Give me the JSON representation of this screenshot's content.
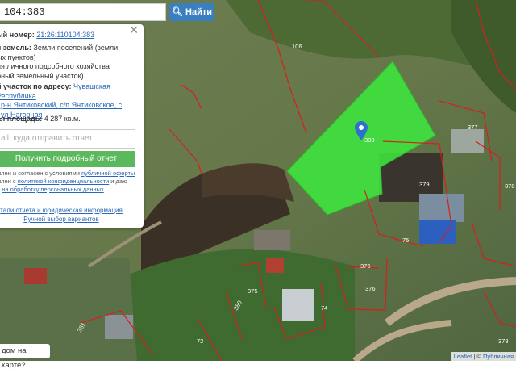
{
  "search": {
    "value": "104:383",
    "button_label": "Найти",
    "button_icon": "search-icon"
  },
  "panel": {
    "cadastral_label": "ый номер:",
    "cadastral_value": "21:26:110104:383",
    "category_label": "я земель:",
    "category_lines": [
      "Земли поселений (земли",
      "ых пунктов)"
    ],
    "use_lines": [
      "ия личного подсобного хозяйства",
      "бный земельный участок)"
    ],
    "address_label": "й участок по адресу:",
    "address_lines": [
      "Чувашская Республика",
      ", р-н Янтиковский, с/п Янтиковское, с",
      ", ул Нагорная"
    ],
    "area_label": "ая площадь:",
    "area_value": "4 287 кв.м.",
    "email_placeholder": "ail, куда отправить отчет",
    "report_button": "Получить подробный отчет",
    "legal_1a": "млен и согласен с условиями ",
    "legal_1b": "публичной оферты",
    "legal_2a": "млен с ",
    "legal_2b": "политикой конфиденциальности",
    "legal_2c": " и даю",
    "legal_3a": "е ",
    "legal_3b": "на обработку персональных данных",
    "details_link": "тали отчета и юридическая информация",
    "manual_link": "Ручной выбор вариантов"
  },
  "on_map_label": "дом на карте?",
  "map": {
    "highlight_color": "#3ee63e",
    "parcel_labels": [
      "106",
      "377",
      "379",
      "378",
      "75",
      "376",
      "376",
      "375",
      "380",
      "74",
      "72",
      "383",
      "381",
      "378"
    ]
  },
  "attribution": {
    "leaflet": "Leaflet",
    "sep": " | © ",
    "provider": "Публичная"
  }
}
